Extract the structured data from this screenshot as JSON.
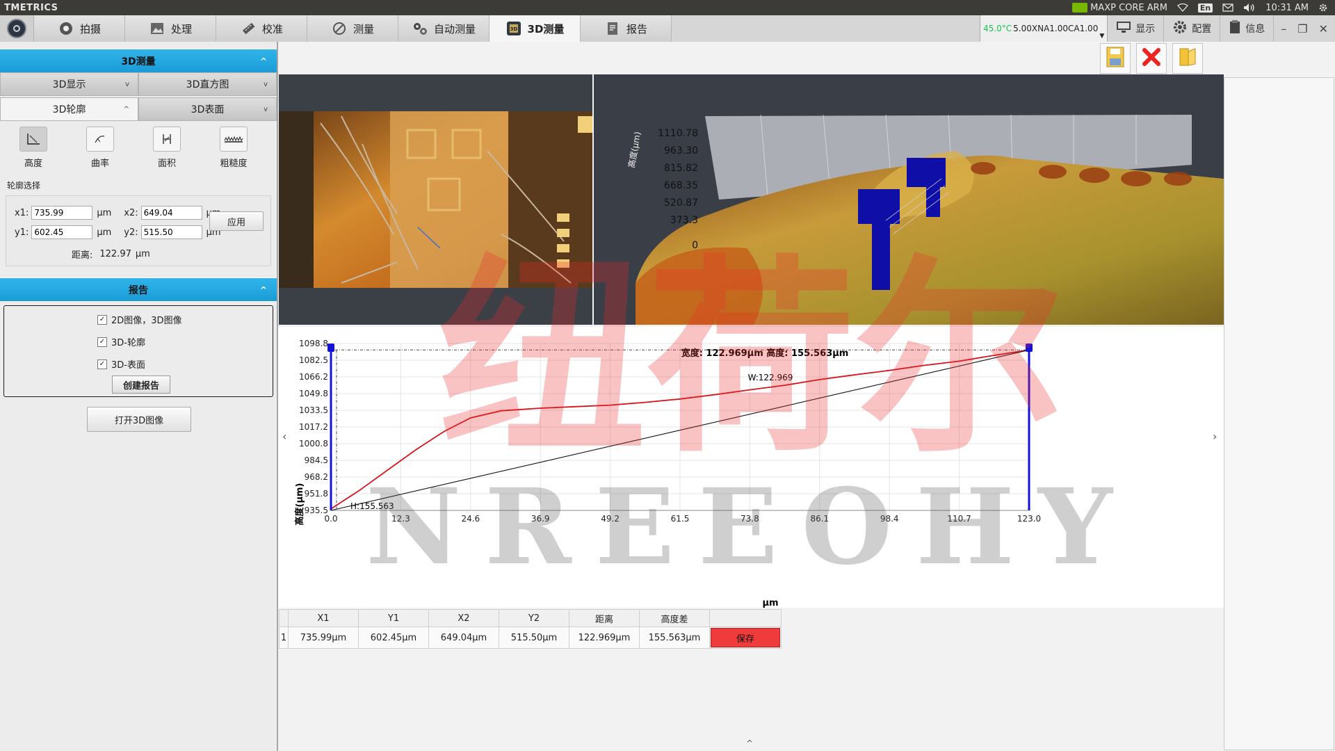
{
  "app": {
    "title": "TMETRICS"
  },
  "tray": {
    "gpu": "MAXP CORE ARM",
    "lang": "En",
    "time": "10:31 AM"
  },
  "tabs": [
    {
      "label": "拍摄",
      "icon": "camera-icon"
    },
    {
      "label": "处理",
      "icon": "image-process-icon"
    },
    {
      "label": "校准",
      "icon": "ruler-icon"
    },
    {
      "label": "测量",
      "icon": "measure-icon"
    },
    {
      "label": "自动测量",
      "icon": "gears-icon"
    },
    {
      "label": "3D测量",
      "icon": "chip-3d-icon",
      "active": true
    },
    {
      "label": "报告",
      "icon": "report-icon"
    }
  ],
  "status": {
    "temperature": "45.0°C",
    "objective": "5.00XNA1.00CA1.00"
  },
  "right_buttons": {
    "display": "显示",
    "config": "配置",
    "info": "信息"
  },
  "left": {
    "section_3d": "3D测量",
    "sub_row1": [
      "3D显示",
      "3D直方图"
    ],
    "sub_row2": [
      "3D轮廓",
      "3D表面"
    ],
    "tools": [
      "高度",
      "曲率",
      "面积",
      "粗糙度"
    ],
    "profile_label": "轮廓选择",
    "x1_label": "x1:",
    "x1": "735.99",
    "x2_label": "x2:",
    "x2": "649.04",
    "y1_label": "y1:",
    "y1": "602.45",
    "y2_label": "y2:",
    "y2": "515.50",
    "unit": "μm",
    "apply": "应用",
    "distance_label": "距离:",
    "distance": "122.97",
    "section_report": "报告",
    "report_options": [
      "2D图像，3D图像",
      "3D-轮廓",
      "3D-表面"
    ],
    "create_report": "创建报告",
    "open_3d": "打开3D图像"
  },
  "view3d": {
    "axis_label": "高度(μm)",
    "ticks": [
      "1110.78",
      "963.30",
      "815.82",
      "668.35",
      "520.87",
      "373.3",
      "0"
    ]
  },
  "watermark": {
    "cn": "纽荷尔",
    "en": "NREEOHY"
  },
  "chart_data": {
    "type": "line",
    "title": "宽度: 122.969μm 高度: 155.563μm",
    "xlabel": "μm",
    "ylabel": "高度(μm)",
    "xlim": [
      0,
      123.0
    ],
    "ylim": [
      935.5,
      1098.8
    ],
    "xticks": [
      "0.0",
      "12.3",
      "24.6",
      "36.9",
      "49.2",
      "61.5",
      "73.8",
      "86.1",
      "98.4",
      "110.7",
      "123.0"
    ],
    "yticks": [
      "1098.8",
      "1082.5",
      "1066.2",
      "1049.8",
      "1033.5",
      "1017.2",
      "1000.8",
      "984.5",
      "968.2",
      "951.8",
      "935.5"
    ],
    "annotations": {
      "width": "W:122.969",
      "height": "H:155.563"
    },
    "series": [
      {
        "color": "#d8141c",
        "x": [
          0,
          5,
          10,
          15,
          20,
          24.6,
          30,
          36.9,
          43,
          49.2,
          55,
          61.5,
          68,
          73.8,
          80,
          86.1,
          92,
          98.4,
          104,
          110.7,
          116,
          123.0
        ],
        "y": [
          937,
          955,
          975,
          995,
          1013,
          1026,
          1033,
          1035.5,
          1037,
          1038.5,
          1041,
          1044.5,
          1049,
          1053.5,
          1058,
          1063.5,
          1068,
          1072.5,
          1077,
          1081.5,
          1086.5,
          1092.5
        ]
      },
      {
        "color": "#111111",
        "x": [
          0,
          123.0
        ],
        "y": [
          935.5,
          1092.5
        ]
      }
    ]
  },
  "table": {
    "headers": [
      "X1",
      "Y1",
      "X2",
      "Y2",
      "距离",
      "高度差",
      ""
    ],
    "rows": [
      {
        "index": "1",
        "cells": [
          "735.99μm",
          "602.45μm",
          "649.04μm",
          "515.50μm",
          "122.969μm",
          "155.563μm"
        ],
        "action": "保存"
      }
    ]
  }
}
